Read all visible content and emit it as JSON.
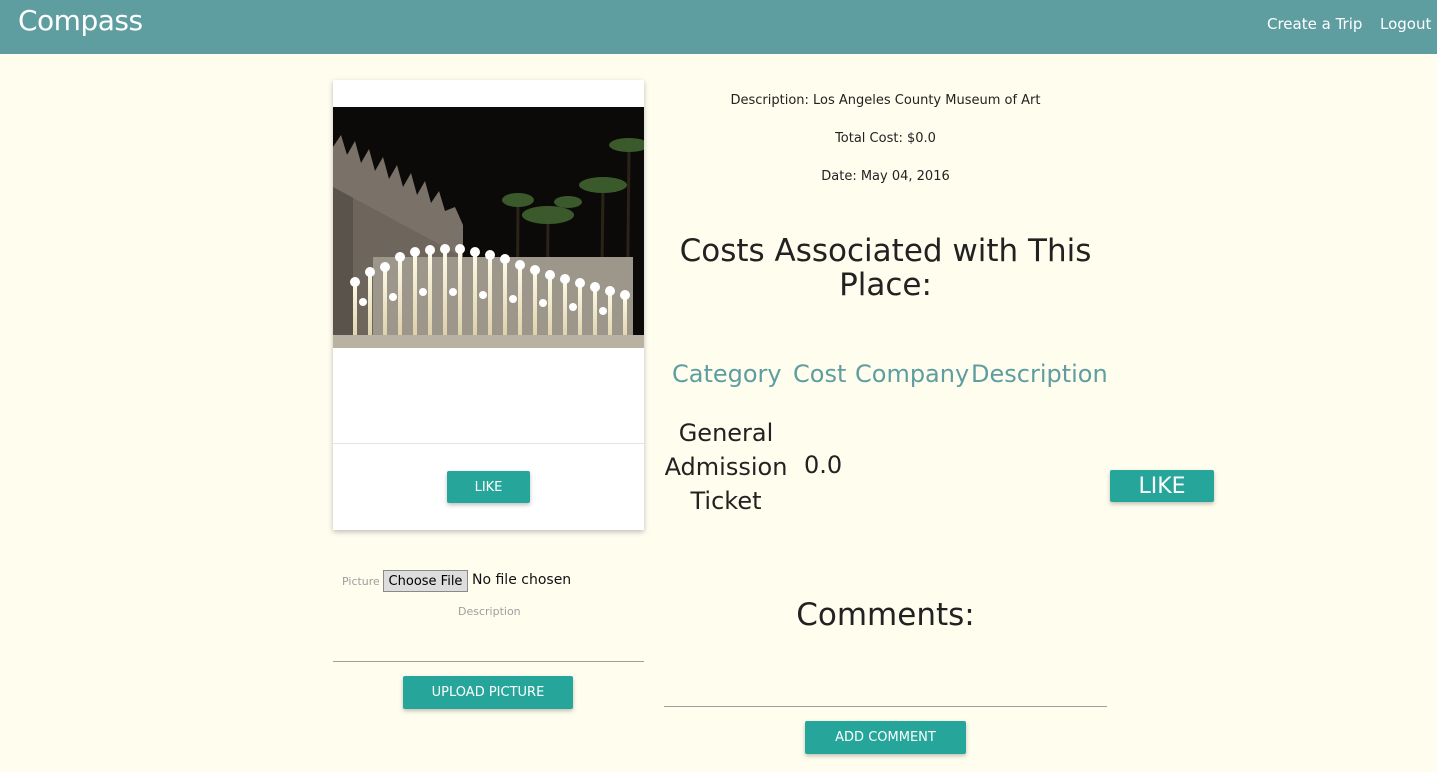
{
  "navbar": {
    "brand": "Compass",
    "links": [
      {
        "label": "Create a Trip"
      },
      {
        "label": "Logout"
      }
    ]
  },
  "card": {
    "like_label": "LIKE"
  },
  "details": {
    "description": "Description: Los Angeles County Museum of Art",
    "total_cost": "Total Cost: $0.0",
    "date": "Date: May 04, 2016"
  },
  "costs": {
    "heading": "Costs Associated with This Place:",
    "columns": [
      "Category",
      "Cost",
      "Company",
      "Description"
    ],
    "rows": [
      {
        "category": "General Admission Ticket",
        "cost": "0.0",
        "company": "",
        "description": ""
      }
    ],
    "like_label": "LIKE"
  },
  "upload": {
    "picture_label": "Picture",
    "choose_file_label": "Choose File",
    "file_status": "No file chosen",
    "description_label": "Description",
    "description_value": "",
    "button_label": "UPLOAD PICTURE"
  },
  "comments": {
    "heading": "Comments:",
    "input_value": "",
    "button_label": "ADD COMMENT"
  },
  "colors": {
    "navbar": "#5f9ea0",
    "accent": "#26a69a",
    "background": "#fffdee"
  }
}
